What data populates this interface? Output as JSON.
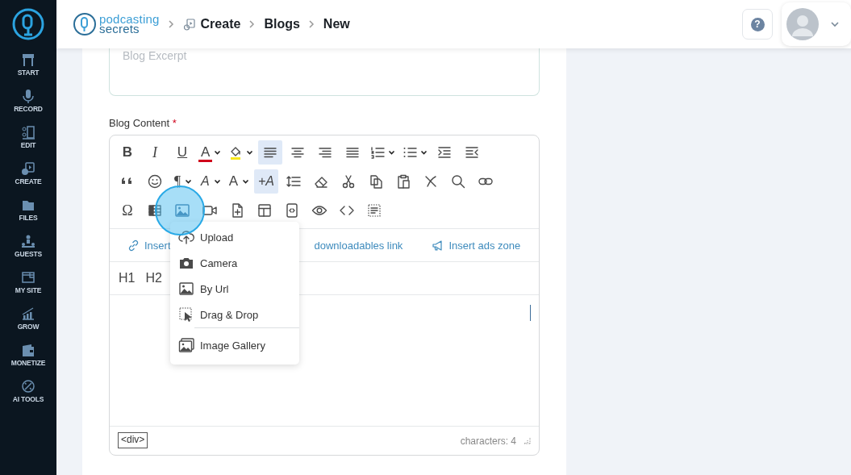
{
  "sidebar": {
    "items": [
      {
        "label": "START"
      },
      {
        "label": "RECORD"
      },
      {
        "label": "EDIT"
      },
      {
        "label": "CREATE"
      },
      {
        "label": "FILES"
      },
      {
        "label": "GUESTS"
      },
      {
        "label": "MY SITE"
      },
      {
        "label": "GROW"
      },
      {
        "label": "MONETIZE"
      },
      {
        "label": "AI TOOLS"
      }
    ]
  },
  "header": {
    "logo": {
      "line_1": "podcasting",
      "line_2": "secrets"
    },
    "breadcrumbs": [
      {
        "label": "Create"
      },
      {
        "label": "Blogs"
      },
      {
        "label": "New"
      }
    ],
    "help_button": {
      "glyph": "?"
    }
  },
  "form": {
    "excerpt": {
      "placeholder": "Blog Excerpt"
    },
    "content_label": {
      "text": "Blog Content",
      "required_mark": "*"
    },
    "editor": {
      "toolbar_rows": [
        [
          {
            "kind": "bold",
            "glyph": "B",
            "active": false,
            "dropdown": false
          },
          {
            "kind": "italic",
            "glyph": "I",
            "active": false,
            "dropdown": false
          },
          {
            "kind": "underline",
            "glyph": "U",
            "active": false,
            "dropdown": false
          },
          {
            "kind": "font-color",
            "glyph": "A",
            "color": "#d0021b",
            "active": false,
            "dropdown": true
          },
          {
            "kind": "highlight",
            "color": "#f8e71c",
            "active": false,
            "dropdown": true
          },
          {
            "kind": "align-left",
            "active": true,
            "dropdown": false
          },
          {
            "kind": "align-center",
            "active": false,
            "dropdown": false
          },
          {
            "kind": "align-right",
            "active": false,
            "dropdown": false
          },
          {
            "kind": "justify",
            "active": false,
            "dropdown": false
          },
          {
            "kind": "ordered-list",
            "active": false,
            "dropdown": true
          },
          {
            "kind": "bullet-list",
            "active": false,
            "dropdown": true
          },
          {
            "kind": "indent",
            "active": false,
            "dropdown": false
          },
          {
            "kind": "outdent",
            "active": false,
            "dropdown": false
          }
        ],
        [
          {
            "kind": "quote",
            "active": false,
            "dropdown": false
          },
          {
            "kind": "emoji",
            "active": false,
            "dropdown": false
          },
          {
            "kind": "paragraph",
            "glyph": "¶",
            "active": false,
            "dropdown": true
          },
          {
            "kind": "font-size",
            "glyph": "A",
            "active": false,
            "dropdown": true
          },
          {
            "kind": "text-case",
            "glyph": "A",
            "active": false,
            "dropdown": true
          },
          {
            "kind": "class",
            "glyph": "+A",
            "active": true,
            "dropdown": false
          },
          {
            "kind": "line-height",
            "active": false,
            "dropdown": false
          },
          {
            "kind": "eraser",
            "active": false,
            "dropdown": false
          },
          {
            "kind": "cut",
            "active": false,
            "dropdown": false
          },
          {
            "kind": "copy",
            "active": false,
            "dropdown": false
          },
          {
            "kind": "paste",
            "active": false,
            "dropdown": false
          },
          {
            "kind": "remove",
            "active": false,
            "dropdown": false
          },
          {
            "kind": "search",
            "active": false,
            "dropdown": false
          },
          {
            "kind": "link",
            "active": false,
            "dropdown": false
          }
        ],
        [
          {
            "kind": "special-char",
            "glyph": "Ω",
            "active": false,
            "dropdown": false
          },
          {
            "kind": "table",
            "active": false,
            "dropdown": false
          },
          {
            "kind": "image",
            "active": false,
            "dropdown": false
          },
          {
            "kind": "video",
            "active": false,
            "dropdown": false
          },
          {
            "kind": "file",
            "active": false,
            "dropdown": false
          },
          {
            "kind": "template",
            "active": false,
            "dropdown": false
          },
          {
            "kind": "embed",
            "active": false,
            "dropdown": false
          },
          {
            "kind": "preview",
            "active": false,
            "dropdown": false
          },
          {
            "kind": "code",
            "active": false,
            "dropdown": false
          },
          {
            "kind": "select-all",
            "active": false,
            "dropdown": false
          }
        ]
      ],
      "insert_links": [
        {
          "label": "Insert"
        },
        {
          "label": "downloadables link"
        },
        {
          "label": "Insert ads zone"
        }
      ],
      "headings": [
        {
          "label": "H1"
        },
        {
          "label": "H2"
        }
      ],
      "footer": {
        "path": "<div>",
        "counter": "characters: 4"
      },
      "image_menu": [
        {
          "kind": "upload",
          "label": "Upload",
          "divider_above": false
        },
        {
          "kind": "camera",
          "label": "Camera",
          "divider_above": false
        },
        {
          "kind": "url",
          "label": "By Url",
          "divider_above": false
        },
        {
          "kind": "drag-drop",
          "label": "Drag & Drop",
          "divider_above": false
        },
        {
          "kind": "gallery",
          "label": "Image Gallery",
          "divider_above": true
        }
      ]
    }
  }
}
